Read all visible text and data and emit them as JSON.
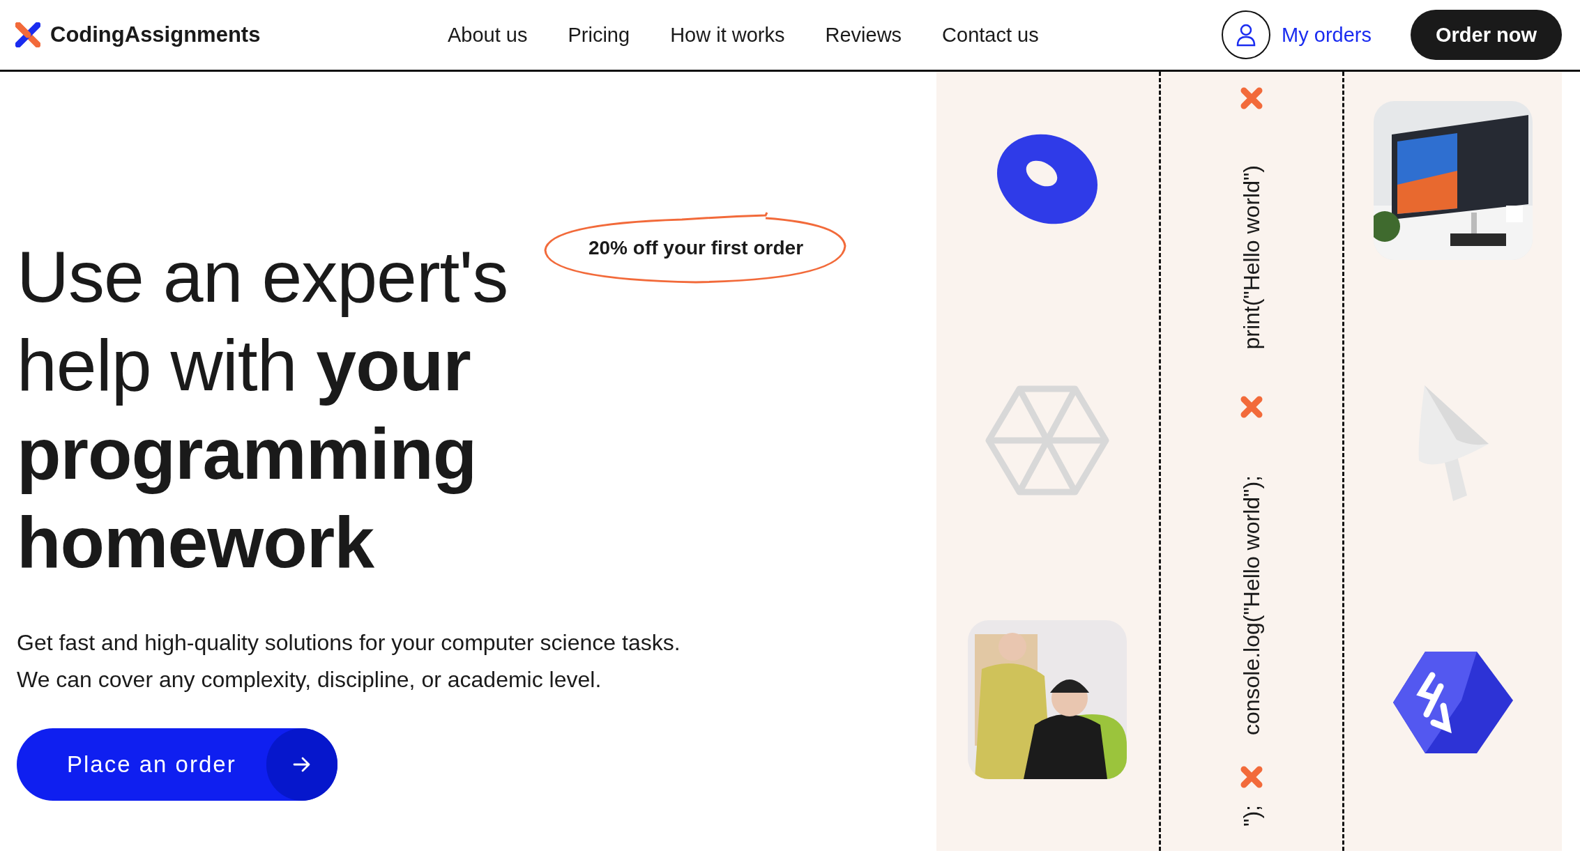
{
  "header": {
    "logo": "CodingAssignments",
    "nav": [
      "About us",
      "Pricing",
      "How it works",
      "Reviews",
      "Contact us"
    ],
    "my_orders": "My orders",
    "order_button": "Order now"
  },
  "hero": {
    "headline": "Use an expert's help with **your programming homework**",
    "badge": "20% off your first order",
    "description": "Get fast and high-quality solutions for your computer science tasks. We can cover any complexity, discipline, or academic level.",
    "cta": "Place an order"
  },
  "showcase": {
    "code_snippets": [
      "print(\"Hello world\")",
      "console.log(\"Hello world\");",
      "\");"
    ],
    "left_column": [
      {
        "kind": "torus"
      },
      {
        "kind": "wire_cube"
      },
      {
        "kind": "picture"
      }
    ],
    "right_column": [
      {
        "kind": "picture"
      },
      {
        "kind": "cone"
      },
      {
        "kind": "code_cube"
      }
    ]
  }
}
